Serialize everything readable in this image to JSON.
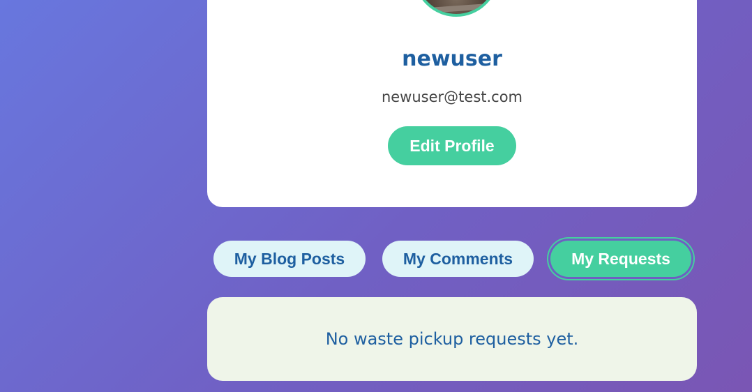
{
  "profile": {
    "username": "newuser",
    "email": "newuser@test.com",
    "edit_label": "Edit Profile",
    "accent_color": "#45cf9f",
    "avatar_icon": "user-avatar-photo"
  },
  "tabs": [
    {
      "label": "My Blog Posts",
      "active": false
    },
    {
      "label": "My Comments",
      "active": false
    },
    {
      "label": "My Requests",
      "active": true
    }
  ],
  "requests": {
    "empty_message": "No waste pickup requests yet."
  }
}
